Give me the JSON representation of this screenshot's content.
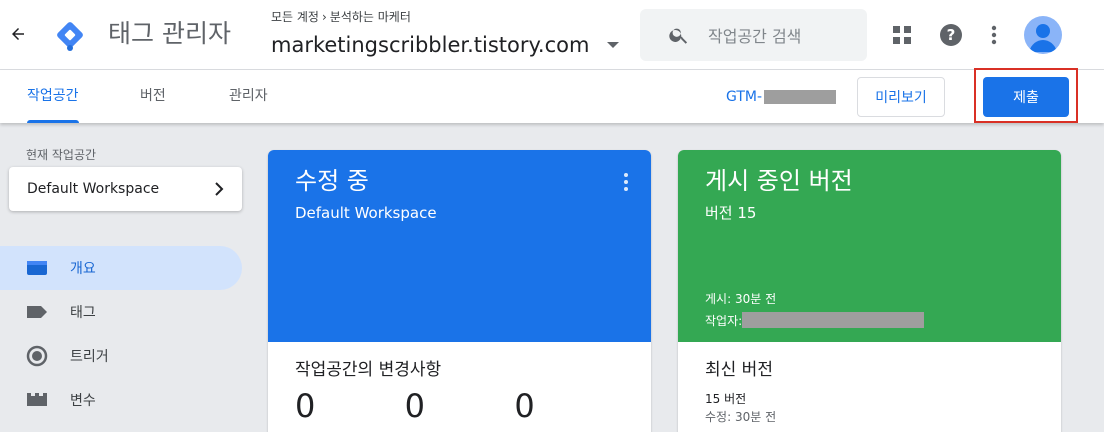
{
  "app": {
    "title": "태그 관리자"
  },
  "account": {
    "all_accounts": "모든 계정",
    "account_name": "분석하는 마케터",
    "container_name": "marketingscribbler.tistory.com"
  },
  "search": {
    "placeholder": "작업공간 검색"
  },
  "tabs": [
    {
      "label": "작업공간",
      "active": true
    },
    {
      "label": "버전",
      "active": false
    },
    {
      "label": "관리자",
      "active": false
    }
  ],
  "container_id_prefix": "GTM-",
  "actions": {
    "preview": "미리보기",
    "submit": "제출"
  },
  "sidebar": {
    "current_workspace_label": "현재 작업공간",
    "workspace": "Default Workspace",
    "nav": [
      {
        "label": "개요",
        "icon": "overview-icon",
        "active": true
      },
      {
        "label": "태그",
        "icon": "tag-icon",
        "active": false
      },
      {
        "label": "트리거",
        "icon": "trigger-icon",
        "active": false
      },
      {
        "label": "변수",
        "icon": "variable-icon",
        "active": false
      }
    ]
  },
  "editing_card": {
    "title": "수정 중",
    "workspace": "Default Workspace",
    "changes_title": "작업공간의 변경사항",
    "counts": [
      "0",
      "0",
      "0"
    ]
  },
  "live_card": {
    "title": "게시 중인 버전",
    "version": "버전 15",
    "published_label": "게시:",
    "published": "30분 전",
    "author_label": "작업자:",
    "latest_title": "최신 버전",
    "latest_version": "15 버전",
    "latest_modified_label": "수정:",
    "latest_modified": "30분 전"
  },
  "colors": {
    "accent": "#1a73e8",
    "live": "#34a853",
    "highlight": "#d93025"
  }
}
